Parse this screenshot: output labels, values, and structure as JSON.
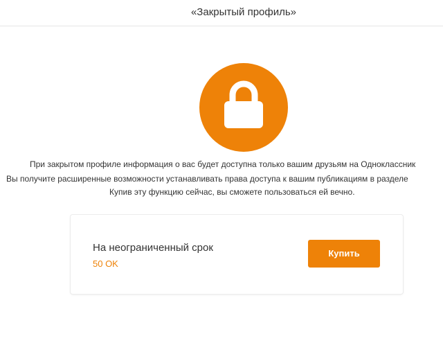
{
  "header": {
    "title": "«Закрытый профиль»"
  },
  "hero": {
    "icon": "lock-icon",
    "accent_color": "#ee8208"
  },
  "info": {
    "line1": "При закрытом профиле информация о вас будет доступна только вашим друзьям на Одноклассник",
    "line2": "Вы получите расширенные возможности устанавливать права доступа к вашим публикациям в разделе",
    "line3": "Купив эту функцию сейчас, вы сможете пользоваться ей вечно."
  },
  "offer": {
    "term": "На неограниченный срок",
    "price": "50 OK",
    "buy_label": "Купить"
  }
}
